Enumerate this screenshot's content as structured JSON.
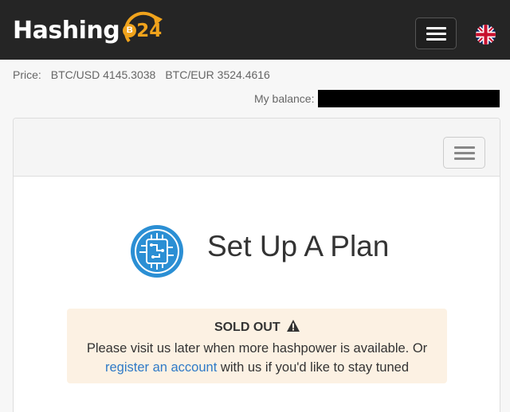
{
  "brand": {
    "name": "Hashing",
    "badge_number": "24",
    "coin_symbol": "B"
  },
  "colors": {
    "navbar": "#252525",
    "accent": "#f0a31c",
    "link": "#2f7ac7",
    "alert_bg": "#fcf1e3",
    "plan_icon": "#2b8fd4"
  },
  "header": {
    "menu_icon": "hamburger-menu-icon",
    "language_icon": "uk-flag-icon"
  },
  "prices": {
    "label": "Price:",
    "btc_usd": "BTC/USD 4145.3038",
    "btc_eur": "BTC/EUR 3524.4616"
  },
  "balance": {
    "label": "My balance:",
    "value": ""
  },
  "panel": {
    "menu_icon": "hamburger-menu-icon",
    "title": "Set Up A Plan",
    "title_icon": "circuit-chip-icon"
  },
  "alert": {
    "title": "SOLD OUT",
    "title_icon": "warning-icon",
    "line1": "Please visit us later when more hashpower is available. Or",
    "link_text": "register an account",
    "line2_rest": " with us if you'd like to stay tuned"
  }
}
